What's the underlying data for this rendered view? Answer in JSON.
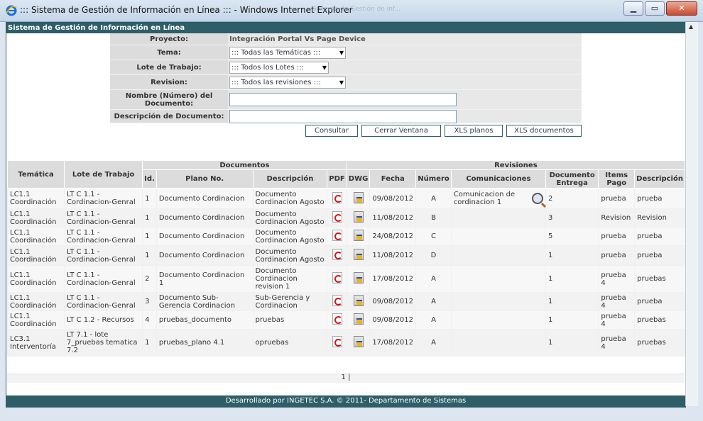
{
  "window": {
    "title": "::: Sistema de Gestión de Información en Línea ::: - Windows Internet Explorer",
    "ghost_tab": "Sistema de Gestión de Inf... ",
    "minimize": "▁",
    "maximize": "▭",
    "close": "✕"
  },
  "header": {
    "title": "Sistema de Gestión de Información en Línea"
  },
  "form": {
    "proyecto_label": "Proyecto:",
    "proyecto_value": "Integración Portal Vs Page Device",
    "tema_label": "Tema:",
    "tema_value": "::: Todas las Temáticas :::",
    "lote_label": "Lote de Trabajo:",
    "lote_value": "::: Todos los Lotes :::",
    "revision_label": "Revision:",
    "revision_value": "::: Todos las revisiones :::",
    "nombre_label": "Nombre (Número) del Documento:",
    "nombre_value": "",
    "descripcion_label": "Descripción de Documento:",
    "descripcion_value": ""
  },
  "buttons": {
    "consultar": "Consultar",
    "cerrar": "Cerrar Ventana",
    "xls_planos": "XLS planos",
    "xls_documentos": "XLS documentos"
  },
  "table": {
    "group_documentos": "Documentos",
    "group_revisiones": "Revisiones",
    "h_tematica": "Temática",
    "h_lote": "Lote de Trabajo",
    "h_id": "Id.",
    "h_plano": "Plano No.",
    "h_descripcion": "Descripción",
    "h_pdf": "PDF",
    "h_dwg": "DWG",
    "h_fecha": "Fecha",
    "h_numero": "Número",
    "h_comunicaciones": "Comunicaciones",
    "h_doc_entrega": "Documento Entrega",
    "h_items_pago": "Items Pago",
    "h_rev_descripcion": "Descripción",
    "rows": [
      {
        "tematica": "LC1.1 Coordinación",
        "lote": "LT C 1.1 - Cordinacion-Genral",
        "id": "1",
        "plano": "Documento Cordinacion",
        "descripcion": "Documento Cordinacion Agosto",
        "fecha": "09/08/2012",
        "numero": "A",
        "comunicacion": "Comunicacion de cordinacion 1",
        "entrega": "2",
        "items": "prueba",
        "rev_desc": "prueba"
      },
      {
        "tematica": "LC1.1 Coordinación",
        "lote": "LT C 1.1 - Cordinacion-Genral",
        "id": "1",
        "plano": "Documento Cordinacion",
        "descripcion": "Documento Cordinacion Agosto",
        "fecha": "11/08/2012",
        "numero": "B",
        "comunicacion": "",
        "entrega": "3",
        "items": "Revision",
        "rev_desc": "Revision"
      },
      {
        "tematica": "LC1.1 Coordinación",
        "lote": "LT C 1.1 - Cordinacion-Genral",
        "id": "1",
        "plano": "Documento Cordinacion",
        "descripcion": "Documento Cordinacion Agosto",
        "fecha": "24/08/2012",
        "numero": "C",
        "comunicacion": "",
        "entrega": "5",
        "items": "prueba",
        "rev_desc": "prueba"
      },
      {
        "tematica": "LC1.1 Coordinación",
        "lote": "LT C 1.1 - Cordinacion-Genral",
        "id": "1",
        "plano": "Documento Cordinacion",
        "descripcion": "Documento Cordinacion Agosto",
        "fecha": "11/08/2012",
        "numero": "D",
        "comunicacion": "",
        "entrega": "1",
        "items": "prueba",
        "rev_desc": "prueba"
      },
      {
        "tematica": "LC1.1 Coordinación",
        "lote": "LT C 1.1 - Cordinacion-Genral",
        "id": "2",
        "plano": "Documento Cordinacion 1",
        "descripcion": "Documento Cordinacion revision 1",
        "fecha": "17/08/2012",
        "numero": "A",
        "comunicacion": "",
        "entrega": "1",
        "items": "prueba 4",
        "rev_desc": "pruebas"
      },
      {
        "tematica": "LC1.1 Coordinación",
        "lote": "LT C 1.1 - Cordinacion-Genral",
        "id": "3",
        "plano": "Documento Sub-Gerencia Cordinacion",
        "descripcion": "Sub-Gerencia y Cordinacion",
        "fecha": "09/08/2012",
        "numero": "A",
        "comunicacion": "",
        "entrega": "1",
        "items": "prueba 4",
        "rev_desc": "prueba"
      },
      {
        "tematica": "LC1.1 Coordinación",
        "lote": "LT C 1.2 - Recursos",
        "id": "4",
        "plano": "pruebas_documento",
        "descripcion": "pruebas",
        "fecha": "09/08/2012",
        "numero": "A",
        "comunicacion": "",
        "entrega": "1",
        "items": "prueba 4",
        "rev_desc": "pruebas"
      },
      {
        "tematica": "LC3.1 Interventoría",
        "lote": "LT 7.1 - lote 7_pruebas tematica 7.2",
        "id": "1",
        "plano": "pruebas_plano 4.1",
        "descripcion": "opruebas",
        "fecha": "17/08/2012",
        "numero": "A",
        "comunicacion": "",
        "entrega": "1",
        "items": "prueba 4",
        "rev_desc": "pruebas"
      }
    ]
  },
  "pager": {
    "text": "1 |"
  },
  "footer": {
    "text": "Desarrollado por INGETEC S.A. © 2011- Departamento de Sistemas"
  },
  "icons": {
    "pdf": "pdf-icon",
    "dwg": "dwg-icon",
    "search": "magnifier-icon"
  },
  "colors": {
    "accent": "#2e5e68"
  }
}
